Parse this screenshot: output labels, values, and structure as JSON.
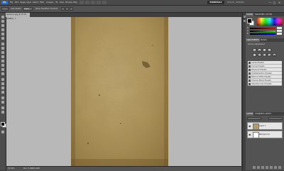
{
  "app": {
    "logo": "Ps"
  },
  "menubar": {
    "items": [
      "File",
      "Edit",
      "Image",
      "Layer",
      "Select",
      "Filter",
      "Analysis",
      "3D",
      "View",
      "Window",
      "Help"
    ],
    "workspace": "ESSENTIALS",
    "workspace_links": [
      "DESIGN",
      "PAINTING"
    ],
    "window_controls": [
      "—",
      "□",
      "✕"
    ]
  },
  "options_bar": {
    "text1": "Auto-Select:",
    "select_value": "Layer",
    "text2": "Show Transform Controls"
  },
  "document": {
    "tab_title": "texture-1.jpg @ 33.3% (RGB/8)",
    "tab_close": "×"
  },
  "statusbar": {
    "zoom": "33.33%",
    "doc_info": "Doc: 5.49M/5.49M"
  },
  "color_panel": {
    "tabs": [
      "COLOR",
      "SWATCHES",
      "STYLES"
    ],
    "sliders": [
      {
        "label": "R",
        "value": ""
      },
      {
        "label": "G",
        "value": ""
      },
      {
        "label": "B",
        "value": ""
      }
    ]
  },
  "adjustments_panel": {
    "tabs": [
      "ADJUSTMENTS",
      "MASKS"
    ],
    "subtitle": "Add an adjustment",
    "presets": [
      "Levels Presets",
      "Curves Presets",
      "Exposure Presets",
      "Hue/Saturation Presets",
      "Black & White Presets",
      "Channel Mixer Presets",
      "Selective Color Presets"
    ]
  },
  "layers_panel": {
    "tabs": [
      "LAYERS",
      "CHANNELS",
      "PATHS"
    ],
    "layers": [
      {
        "name": "Layer 1"
      },
      {
        "name": "Background"
      }
    ]
  },
  "colors": {
    "accent": "#2b6dd3",
    "panel": "#535353",
    "canvas": "#b8b8b8"
  }
}
